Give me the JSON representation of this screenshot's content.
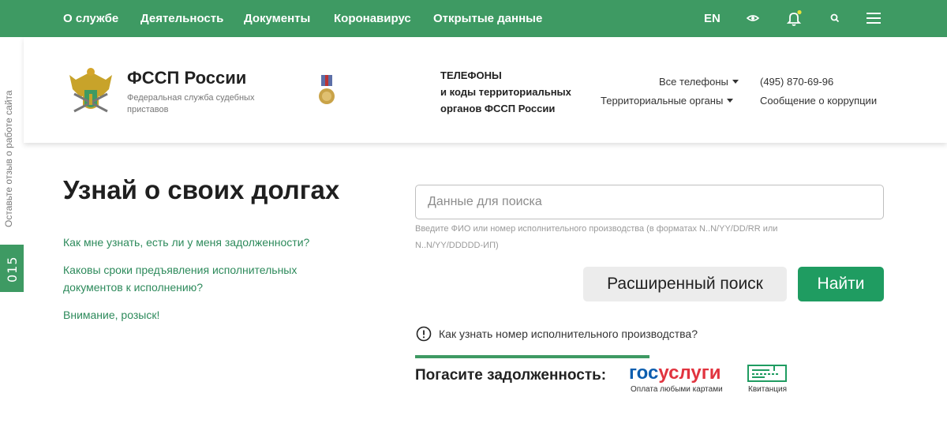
{
  "colors": {
    "brand_green": "#3e9a63",
    "button_green": "#1f9c61",
    "link_green": "#2d8a5b",
    "gos_blue": "#0d5eaf",
    "gos_red": "#e1343f"
  },
  "nav": {
    "items": [
      {
        "label": "О службе"
      },
      {
        "label": "Деятельность"
      },
      {
        "label": "Документы"
      },
      {
        "label": "Коронавирус"
      },
      {
        "label": "Открытые данные"
      }
    ],
    "lang": "EN",
    "icons": [
      "eye-icon",
      "bell-icon",
      "search-icon",
      "menu-icon"
    ]
  },
  "side": {
    "feedback": "Оставьте отзыв о работе сайта",
    "badge": "015"
  },
  "header": {
    "title": "ФССП России",
    "subtitle": "Федеральная служба судебных приставов",
    "phones_title": "ТЕЛЕФОНЫ",
    "phones_line2": "и коды территориальных",
    "phones_line3": "органов ФССП России",
    "all_phones": "Все телефоны",
    "territorial": "Территориальные органы",
    "phone": "(495) 870-69-96",
    "corruption": "Сообщение о коррупции"
  },
  "main": {
    "title": "Узнай о своих долгах",
    "links": [
      {
        "label": "Как мне узнать, есть ли у меня задолженности?"
      },
      {
        "label": "Каковы сроки предъявления исполнительных документов к исполнению?"
      },
      {
        "label": "Внимание, розыск!"
      }
    ],
    "search_placeholder": "Данные для поиска",
    "hint": "Введите ФИО или номер исполнительного производства (в форматах N..N/YY/DD/RR или N..N/YY/DDDDD-ИП)",
    "advanced_button": "Расширенный поиск",
    "find_button": "Найти",
    "how_to": "Как узнать номер исполнительного производства?",
    "pay_label": "Погасите задолженность:",
    "gos_part1": "гос",
    "gos_part2": "услуги",
    "gos_sub": "Оплата любыми картами",
    "receipt_sub": "Квитанция"
  }
}
